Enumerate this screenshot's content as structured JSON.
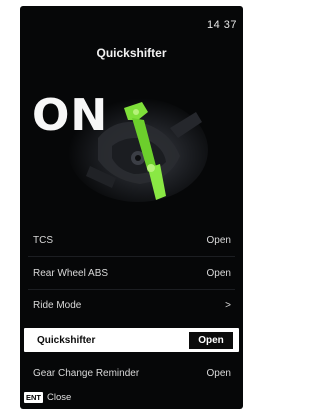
{
  "status": {
    "time": "14 37"
  },
  "header": {
    "title": "Quickshifter"
  },
  "hero": {
    "state_text": "ON"
  },
  "menu": {
    "items": [
      {
        "label": "TCS",
        "value": "Open"
      },
      {
        "label": "Rear Wheel ABS",
        "value": "Open"
      },
      {
        "label": "Ride Mode",
        "value": ">"
      },
      {
        "label": "Quickshifter",
        "value": "Open"
      },
      {
        "label": "Gear Change Reminder",
        "value": "Open"
      }
    ]
  },
  "footer": {
    "key": "ENT",
    "action": "Close"
  },
  "colors": {
    "accent": "#7fe03a",
    "background": "#060708",
    "highlight": "#ffffff"
  }
}
